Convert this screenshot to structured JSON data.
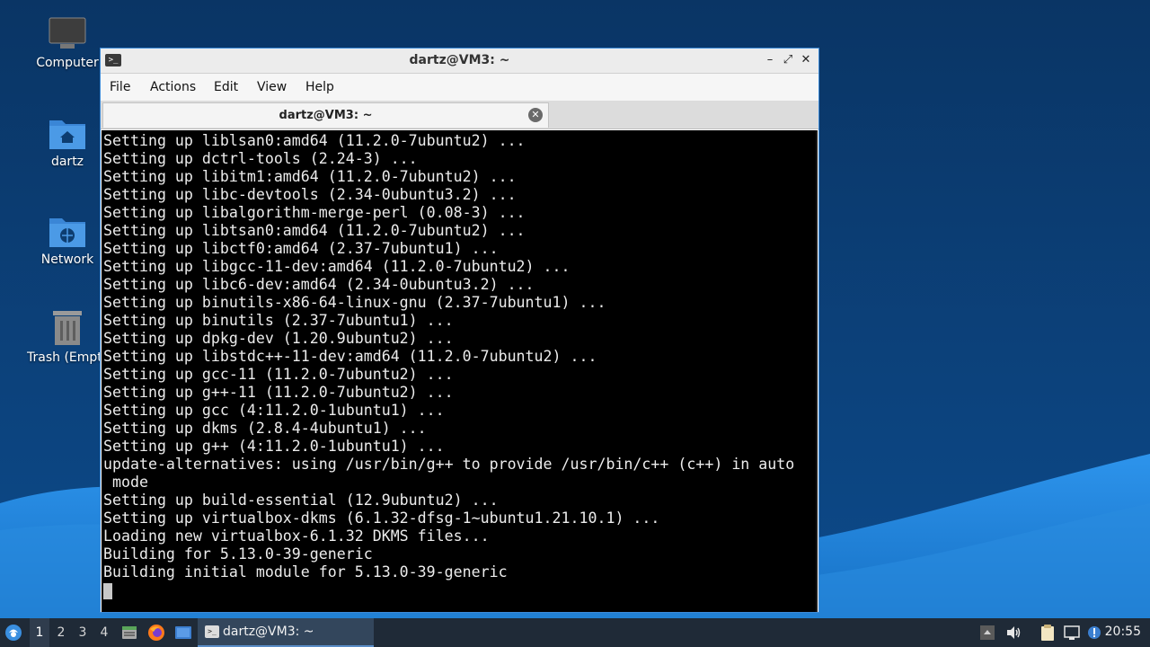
{
  "colors": {
    "desktop_dark": "#0b3a6e",
    "desktop_wave": "#1e7fd6",
    "window_border": "#3c8ad8",
    "terminal_bg": "#000000",
    "terminal_fg": "#ececec",
    "taskbar_bg": "#1f2a37"
  },
  "desktop": {
    "icons": [
      {
        "label": "Computer",
        "icon": "computer-icon"
      },
      {
        "label": "dartz",
        "icon": "home-folder-icon"
      },
      {
        "label": "Network",
        "icon": "network-folder-icon"
      },
      {
        "label": "Trash (Empty)",
        "icon": "trash-icon"
      }
    ]
  },
  "window": {
    "title": "dartz@VM3: ~",
    "controls": {
      "minimize": "–",
      "maximize": "⤢",
      "close": "✕"
    },
    "menu": [
      "File",
      "Actions",
      "Edit",
      "View",
      "Help"
    ],
    "tab": {
      "title": "dartz@VM3: ~",
      "close": "✕"
    }
  },
  "terminal": {
    "lines": [
      "Setting up liblsan0:amd64 (11.2.0-7ubuntu2) ...",
      "Setting up dctrl-tools (2.24-3) ...",
      "Setting up libitm1:amd64 (11.2.0-7ubuntu2) ...",
      "Setting up libc-devtools (2.34-0ubuntu3.2) ...",
      "Setting up libalgorithm-merge-perl (0.08-3) ...",
      "Setting up libtsan0:amd64 (11.2.0-7ubuntu2) ...",
      "Setting up libctf0:amd64 (2.37-7ubuntu1) ...",
      "Setting up libgcc-11-dev:amd64 (11.2.0-7ubuntu2) ...",
      "Setting up libc6-dev:amd64 (2.34-0ubuntu3.2) ...",
      "Setting up binutils-x86-64-linux-gnu (2.37-7ubuntu1) ...",
      "Setting up binutils (2.37-7ubuntu1) ...",
      "Setting up dpkg-dev (1.20.9ubuntu2) ...",
      "Setting up libstdc++-11-dev:amd64 (11.2.0-7ubuntu2) ...",
      "Setting up gcc-11 (11.2.0-7ubuntu2) ...",
      "Setting up g++-11 (11.2.0-7ubuntu2) ...",
      "Setting up gcc (4:11.2.0-1ubuntu1) ...",
      "Setting up dkms (2.8.4-4ubuntu1) ...",
      "Setting up g++ (4:11.2.0-1ubuntu1) ...",
      "update-alternatives: using /usr/bin/g++ to provide /usr/bin/c++ (c++) in auto",
      " mode",
      "Setting up build-essential (12.9ubuntu2) ...",
      "Setting up virtualbox-dkms (6.1.32-dfsg-1~ubuntu1.21.10.1) ...",
      "Loading new virtualbox-6.1.32 DKMS files...",
      "Building for 5.13.0-39-generic",
      "Building initial module for 5.13.0-39-generic"
    ]
  },
  "taskbar": {
    "start_icon": "lubuntu-logo-icon",
    "workspaces": [
      "1",
      "2",
      "3",
      "4"
    ],
    "active_workspace": "1",
    "launchers": [
      "file-manager-icon",
      "firefox-icon",
      "show-desktop-icon"
    ],
    "task_label": "dartz@VM3: ~",
    "tray_icons": [
      "tray-up-arrow-icon",
      "volume-icon",
      "clipboard-icon",
      "network-monitor-icon",
      "update-notifier-icon"
    ],
    "clock": "20:55"
  }
}
